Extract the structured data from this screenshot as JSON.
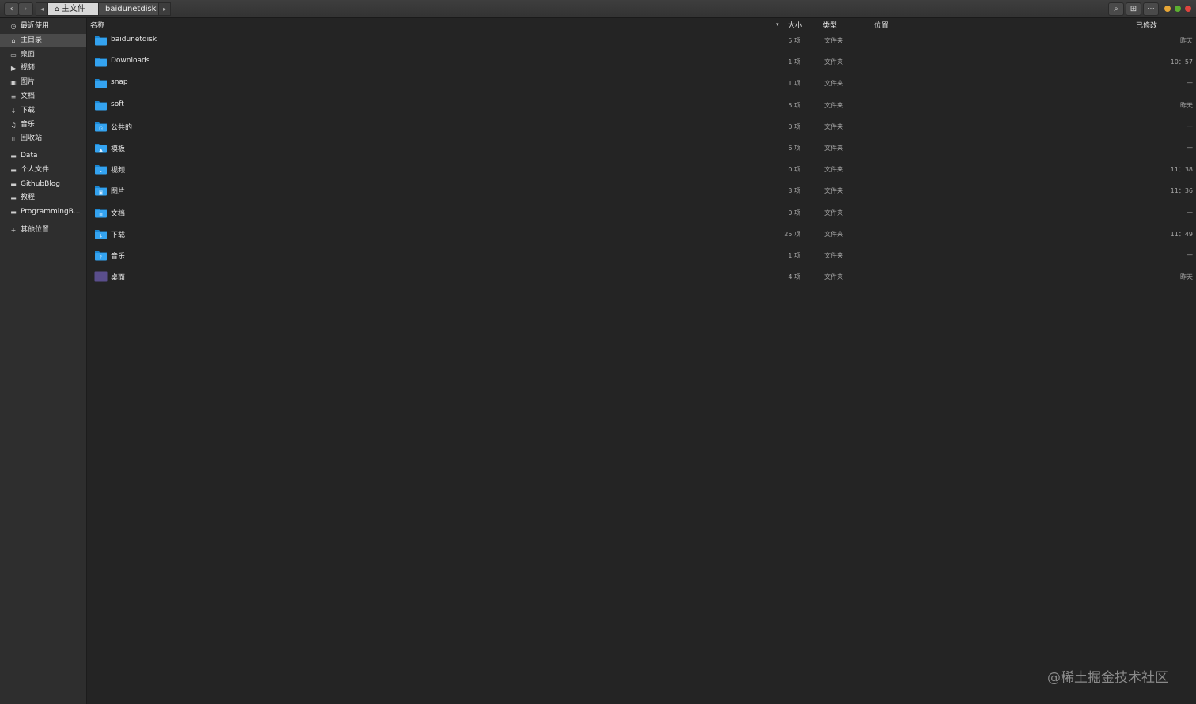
{
  "toolbar": {
    "back_glyph": "‹",
    "forward_glyph": "›",
    "breadcrumb_left_glyph": "◂",
    "breadcrumb_right_glyph": "▸",
    "breadcrumbs": [
      {
        "label": "主文件夹",
        "icon": "home-icon"
      },
      {
        "label": "baidunetdisk"
      }
    ],
    "search_glyph": "⌕",
    "view_glyph": "⊞",
    "menu_glyph": "⋯",
    "window_controls": {
      "minimize": "#e8a736",
      "maximize": "#5cb030",
      "close": "#e0443e"
    }
  },
  "sidebar": {
    "items": [
      {
        "label": "最近使用",
        "icon": "clock-icon",
        "glyph": "◷"
      },
      {
        "label": "主目录",
        "icon": "home-icon",
        "glyph": "⌂",
        "selected": true
      },
      {
        "label": "桌面",
        "icon": "desktop-icon",
        "glyph": "▭"
      },
      {
        "label": "视频",
        "icon": "video-icon",
        "glyph": "▶"
      },
      {
        "label": "图片",
        "icon": "picture-icon",
        "glyph": "▣"
      },
      {
        "label": "文档",
        "icon": "document-icon",
        "glyph": "≡"
      },
      {
        "label": "下载",
        "icon": "download-icon",
        "glyph": "↓"
      },
      {
        "label": "音乐",
        "icon": "music-icon",
        "glyph": "♫"
      },
      {
        "label": "回收站",
        "icon": "trash-icon",
        "glyph": "▯"
      }
    ],
    "bookmarks": [
      {
        "label": "Data",
        "icon": "folder-icon",
        "glyph": "▬"
      },
      {
        "label": "个人文件",
        "icon": "folder-icon",
        "glyph": "▬"
      },
      {
        "label": "GithubBlog",
        "icon": "folder-icon",
        "glyph": "▬"
      },
      {
        "label": "教程",
        "icon": "folder-icon",
        "glyph": "▬"
      },
      {
        "label": "ProgrammingB...",
        "icon": "folder-icon",
        "glyph": "▬"
      }
    ],
    "other": {
      "label": "其他位置",
      "icon": "plus-icon",
      "glyph": "+"
    }
  },
  "columns": {
    "name": "名称",
    "sort_glyph": "▾",
    "size": "大小",
    "type": "类型",
    "location": "位置",
    "modified": "已修改"
  },
  "files": [
    {
      "name": "baidunetdisk",
      "size": "5 项",
      "type": "文件夹",
      "modified": "昨天",
      "icon": "folder-icon"
    },
    {
      "name": "Downloads",
      "size": "1 项",
      "type": "文件夹",
      "modified": "10：57",
      "icon": "folder-icon"
    },
    {
      "name": "snap",
      "size": "1 项",
      "type": "文件夹",
      "modified": "—",
      "icon": "folder-icon"
    },
    {
      "name": "soft",
      "size": "5 项",
      "type": "文件夹",
      "modified": "昨天",
      "icon": "folder-icon"
    },
    {
      "name": "公共的",
      "size": "0 项",
      "type": "文件夹",
      "modified": "—",
      "icon": "folder-public-icon"
    },
    {
      "name": "模板",
      "size": "6 项",
      "type": "文件夹",
      "modified": "—",
      "icon": "folder-templates-icon"
    },
    {
      "name": "视频",
      "size": "0 项",
      "type": "文件夹",
      "modified": "11：38",
      "icon": "folder-videos-icon"
    },
    {
      "name": "图片",
      "size": "3 项",
      "type": "文件夹",
      "modified": "11：36",
      "icon": "folder-pictures-icon"
    },
    {
      "name": "文档",
      "size": "0 项",
      "type": "文件夹",
      "modified": "—",
      "icon": "folder-documents-icon"
    },
    {
      "name": "下载",
      "size": "25 项",
      "type": "文件夹",
      "modified": "11：49",
      "icon": "folder-download-icon"
    },
    {
      "name": "音乐",
      "size": "1 项",
      "type": "文件夹",
      "modified": "—",
      "icon": "folder-music-icon"
    },
    {
      "name": "桌面",
      "size": "4 项",
      "type": "文件夹",
      "modified": "昨天",
      "icon": "folder-desktop-icon"
    }
  ],
  "watermark": "@稀土掘金技术社区"
}
